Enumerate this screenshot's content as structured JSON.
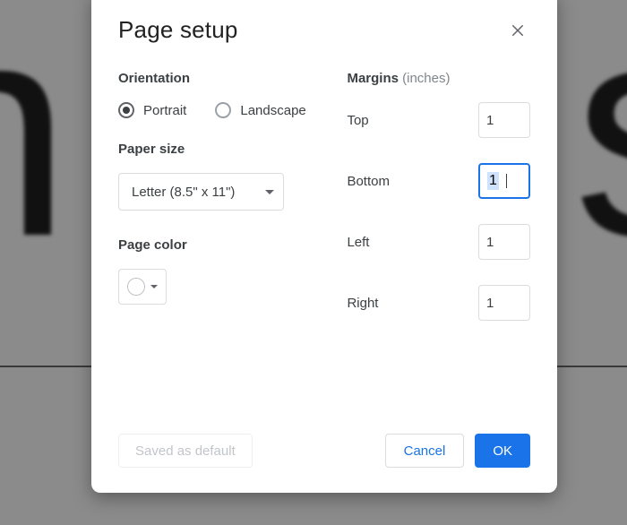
{
  "dialog": {
    "title": "Page setup"
  },
  "orientation": {
    "label": "Orientation",
    "portrait": "Portrait",
    "landscape": "Landscape",
    "selected": "portrait"
  },
  "paper_size": {
    "label": "Paper size",
    "value": "Letter (8.5\" x 11\")"
  },
  "page_color": {
    "label": "Page color",
    "value": "#ffffff"
  },
  "margins": {
    "label": "Margins",
    "hint": "(inches)",
    "top": {
      "label": "Top",
      "value": "1"
    },
    "bottom": {
      "label": "Bottom",
      "value": "1"
    },
    "left": {
      "label": "Left",
      "value": "1"
    },
    "right": {
      "label": "Right",
      "value": "1"
    },
    "focused": "bottom"
  },
  "buttons": {
    "saved_default": "Saved as default",
    "cancel": "Cancel",
    "ok": "OK"
  }
}
